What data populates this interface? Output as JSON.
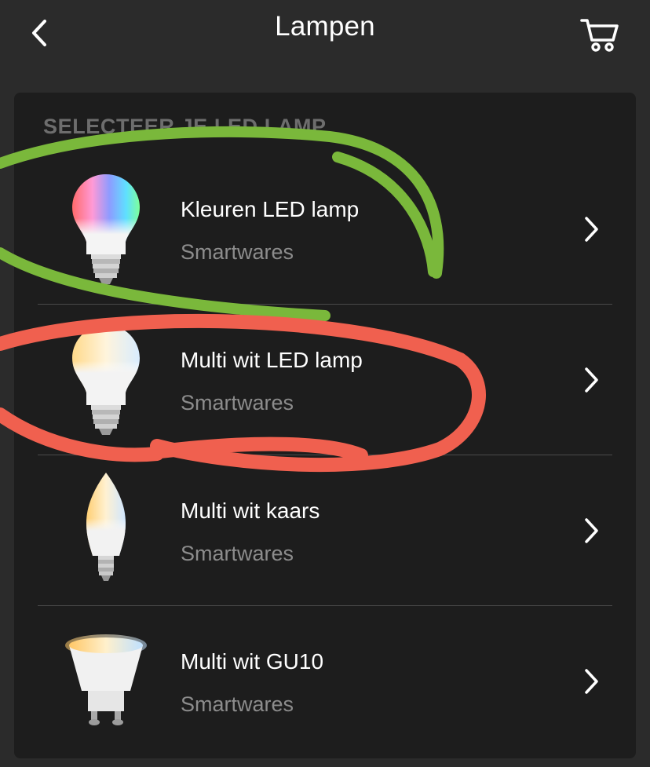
{
  "header": {
    "title": "Lampen",
    "back_icon": "chevron-left-icon",
    "cart_icon": "shopping-cart-icon"
  },
  "section": {
    "title": "SELECTEER JE LED LAMP"
  },
  "items": [
    {
      "name": "Kleuren LED lamp",
      "brand": "Smartwares",
      "image": "color-bulb-image"
    },
    {
      "name": "Multi wit LED lamp",
      "brand": "Smartwares",
      "image": "white-bulb-image"
    },
    {
      "name": "Multi wit kaars",
      "brand": "Smartwares",
      "image": "candle-bulb-image"
    },
    {
      "name": "Multi wit GU10",
      "brand": "Smartwares",
      "image": "gu10-spot-image"
    }
  ],
  "annotations": {
    "green_circle_color": "#7ab83b",
    "red_circle_color": "#f0604f"
  },
  "colors": {
    "background": "#2b2b2b",
    "panel": "#1d1d1d",
    "text_primary": "#ffffff",
    "text_secondary": "#8c8c8c"
  }
}
